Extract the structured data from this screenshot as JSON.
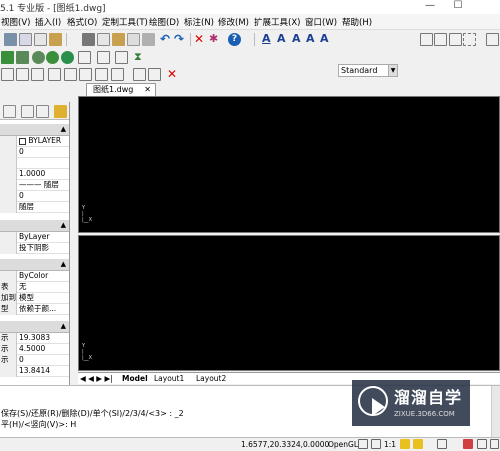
{
  "titlebar": {
    "title": "5.1 专业版 - [图纸1.dwg]",
    "min": "—",
    "max": "☐"
  },
  "menus": [
    "视图(V)",
    "插入(I)",
    "格式(O)",
    "定制工具(T)",
    "绘图(D)",
    "标注(N)",
    "修改(M)",
    "扩展工具(X)",
    "窗口(W)",
    "帮助(H)"
  ],
  "toolbar": {
    "text_style": "Standard"
  },
  "properties": {
    "bylayer_check": "BYLAYER",
    "rows": [
      {
        "k": "",
        "v": "0"
      },
      {
        "k": "",
        "v": "1.0000"
      },
      {
        "k": "",
        "v": "——— 随层"
      },
      {
        "k": "",
        "v": "0"
      },
      {
        "k": "",
        "v": "随层"
      }
    ],
    "rows2": [
      {
        "k": "",
        "v": "ByLayer"
      },
      {
        "k": "",
        "v": "投下阴影"
      }
    ],
    "rows3": [
      {
        "k": "",
        "v": "ByColor"
      },
      {
        "k": "表",
        "v": "无"
      },
      {
        "k": "加到",
        "v": "模型"
      },
      {
        "k": "型",
        "v": "依赖于颜..."
      }
    ],
    "rows4": [
      {
        "k": "示",
        "v": "19.3083"
      },
      {
        "k": "示",
        "v": "4.5000"
      },
      {
        "k": "示",
        "v": "0"
      },
      {
        "k": "",
        "v": "13.8414"
      }
    ]
  },
  "doc_tab": {
    "name": "图纸1.dwg",
    "close": "✕"
  },
  "layout_tabs": {
    "nav": "◀ ◀ ▶ ▶|",
    "model": "Model",
    "l1": "Layout1",
    "l2": "Layout2"
  },
  "command": {
    "line1": "保存(S)/还原(R)/删除(D)/单个(SI)/2/3/4/<3> : _2",
    "line2": "平(H)/<竖向(V)>: H"
  },
  "status": {
    "coords": "1.6577,20.3324,0.0000",
    "opengl": "OpenGL",
    "scale": "1:1"
  },
  "watermark": {
    "brand": "溜溜自学",
    "site": "ZIXUE.3D66.COM"
  },
  "colors": {
    "viewport": "#000000",
    "accent": "#1a5fb4"
  }
}
